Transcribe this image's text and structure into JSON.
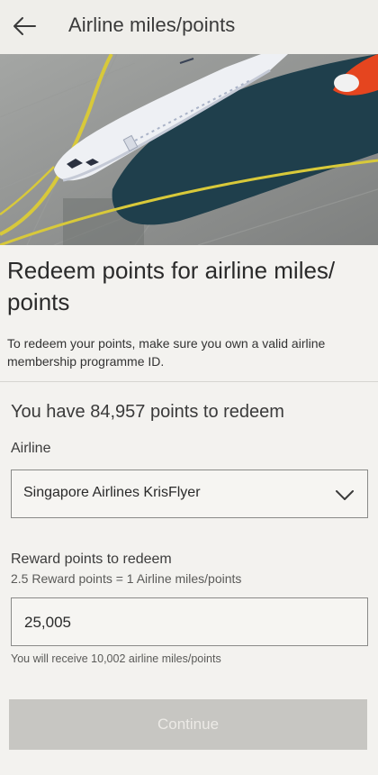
{
  "header": {
    "back_icon": "arrow-left-icon",
    "title": "Airline miles/points"
  },
  "hero": {
    "image": "airplane-on-tarmac-aerial-photo",
    "colors": {
      "tarmac": "#8f918f",
      "shadow": "#1f3f4c",
      "fuselage": "#eef0f4",
      "tail": "#e5451f",
      "marking": "#d8c93a"
    }
  },
  "content": {
    "title": "Redeem points for airline miles/ points",
    "description": "To redeem your points, make sure you own a valid airline membership programme ID.",
    "points_available_text": "You have 84,957 points to redeem"
  },
  "airline": {
    "label": "Airline",
    "selected": "Singapore Airlines KrisFlyer",
    "dropdown_icon": "chevron-down-icon"
  },
  "reward": {
    "label": "Reward points to redeem",
    "rate_text": "2.5 Reward points = 1 Airline miles/points",
    "value": "25,005",
    "receive_text": "You will receive 10,002 airline miles/points"
  },
  "actions": {
    "continue_label": "Continue",
    "continue_enabled": false
  }
}
